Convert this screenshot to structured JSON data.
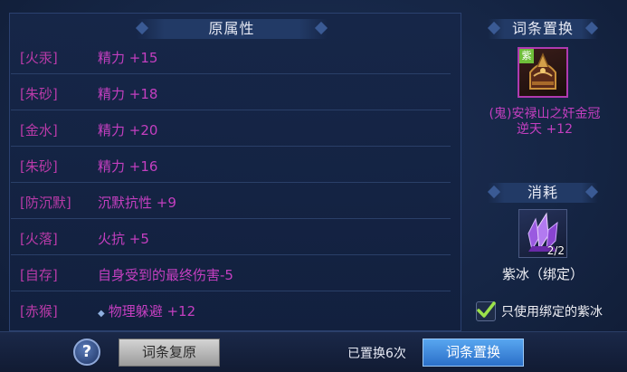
{
  "original_attrs": {
    "title": "原属性",
    "rows": [
      {
        "tag": "[火汞]",
        "value": "精力 +15"
      },
      {
        "tag": "[朱砂]",
        "value": "精力 +18"
      },
      {
        "tag": "[金水]",
        "value": "精力 +20"
      },
      {
        "tag": "[朱砂]",
        "value": "精力 +16"
      },
      {
        "tag": "[防沉默]",
        "value": "沉默抗性 +9"
      },
      {
        "tag": "[火落]",
        "value": "火抗 +5"
      },
      {
        "tag": "[自存]",
        "value": "自身受到的最终伤害-5"
      },
      {
        "tag": "[赤猴]",
        "value": "物理躲避 +12"
      }
    ]
  },
  "replace": {
    "title": "词条置换",
    "item_badge": "紫",
    "item_name_line1": "(鬼)安禄山之奸金冠",
    "item_name_line2": "逆天 +12"
  },
  "consume": {
    "title": "消耗",
    "count": "2/2",
    "item_name": "紫冰（绑定）",
    "checkbox_label": "只使用绑定的紫冰"
  },
  "footer": {
    "help_label": "?",
    "restore_label": "词条复原",
    "replaced_count_text": "已置换6次",
    "replace_label": "词条置换"
  },
  "colors": {
    "purple_text": "#c43fc0",
    "accent_blue": "#3d8ae0",
    "check_green": "#9be24a"
  }
}
